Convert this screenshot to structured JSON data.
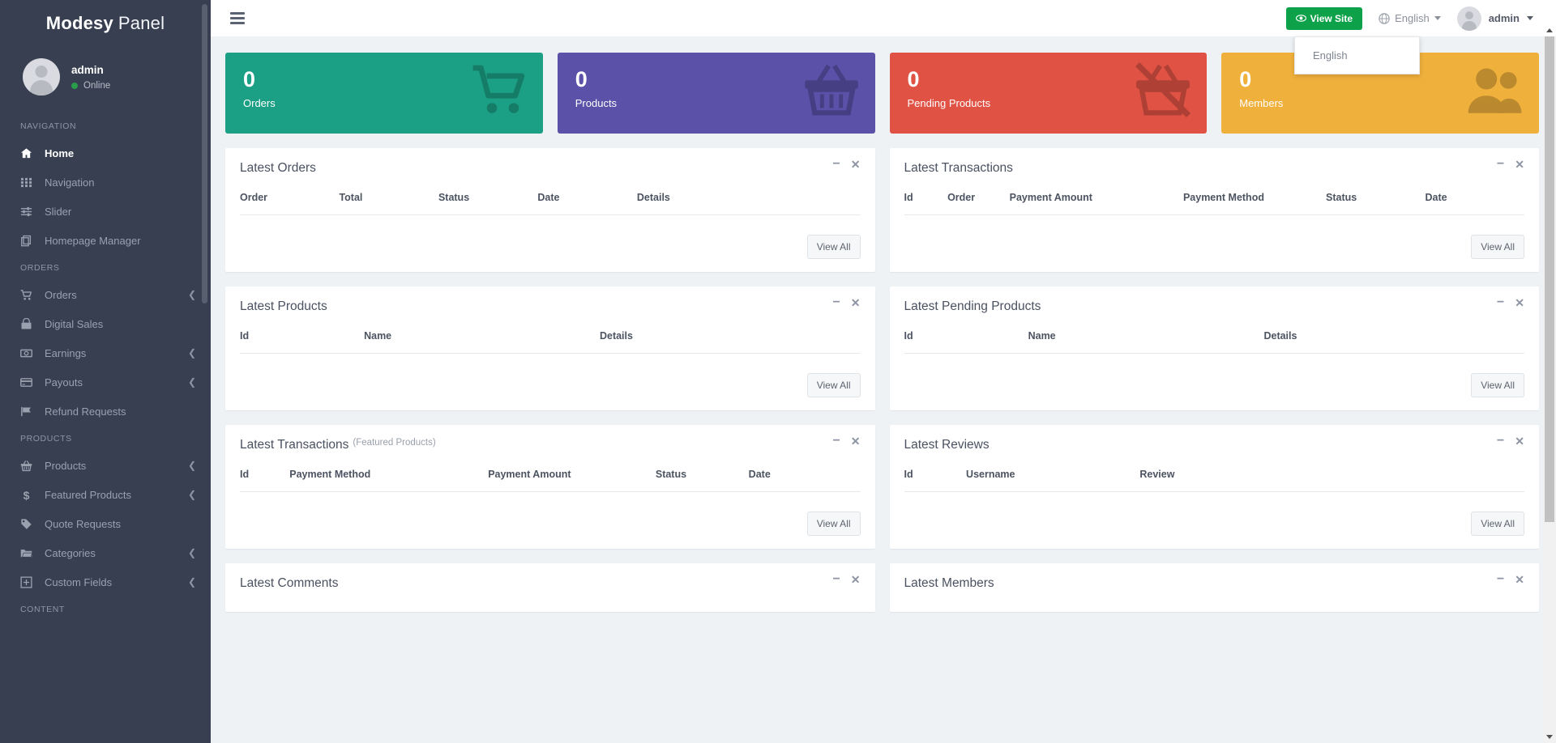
{
  "brand": {
    "bold": "Modesy",
    "light": "Panel"
  },
  "user": {
    "name": "admin",
    "status": "Online"
  },
  "sidebar": {
    "sections": [
      {
        "heading": "NAVIGATION",
        "items": [
          {
            "label": "Home",
            "icon": "home-icon",
            "active": true,
            "caret": false
          },
          {
            "label": "Navigation",
            "icon": "grid-icon",
            "active": false,
            "caret": false
          },
          {
            "label": "Slider",
            "icon": "sliders-icon",
            "active": false,
            "caret": false
          },
          {
            "label": "Homepage Manager",
            "icon": "copy-icon",
            "active": false,
            "caret": false
          }
        ]
      },
      {
        "heading": "ORDERS",
        "items": [
          {
            "label": "Orders",
            "icon": "cart-icon",
            "active": false,
            "caret": true
          },
          {
            "label": "Digital Sales",
            "icon": "bag-icon",
            "active": false,
            "caret": false
          },
          {
            "label": "Earnings",
            "icon": "money-icon",
            "active": false,
            "caret": true
          },
          {
            "label": "Payouts",
            "icon": "card-icon",
            "active": false,
            "caret": true
          },
          {
            "label": "Refund Requests",
            "icon": "flag-icon",
            "active": false,
            "caret": false
          }
        ]
      },
      {
        "heading": "PRODUCTS",
        "items": [
          {
            "label": "Products",
            "icon": "basket-icon",
            "active": false,
            "caret": true
          },
          {
            "label": "Featured Products",
            "icon": "dollar-icon",
            "active": false,
            "caret": true
          },
          {
            "label": "Quote Requests",
            "icon": "tag-icon",
            "active": false,
            "caret": false
          },
          {
            "label": "Categories",
            "icon": "folder-icon",
            "active": false,
            "caret": true
          },
          {
            "label": "Custom Fields",
            "icon": "plus-square-icon",
            "active": false,
            "caret": true
          }
        ]
      },
      {
        "heading": "CONTENT",
        "items": []
      }
    ]
  },
  "topbar": {
    "view_site_label": "View Site",
    "language_label": "English",
    "account_label": "admin",
    "language_options": [
      "English"
    ]
  },
  "stats": [
    {
      "value": "0",
      "label": "Orders",
      "color": "#1ca085",
      "icon": "cart-icon"
    },
    {
      "value": "0",
      "label": "Products",
      "color": "#5b51a8",
      "icon": "basket-icon"
    },
    {
      "value": "0",
      "label": "Pending Products",
      "color": "#e05244",
      "icon": "basket-off-icon"
    },
    {
      "value": "0",
      "label": "Members",
      "color": "#f0b03c",
      "icon": "users-icon"
    }
  ],
  "panels": {
    "left": [
      {
        "title": "Latest Orders",
        "subtitle": "",
        "columns": [
          "Order",
          "Total",
          "Status",
          "Date",
          "Details"
        ],
        "col_widths": [
          "16%",
          "16%",
          "16%",
          "16%",
          "36%"
        ],
        "rows": [],
        "view_all": "View All",
        "has_table": true
      },
      {
        "title": "Latest Products",
        "subtitle": "",
        "columns": [
          "Id",
          "Name",
          "Details"
        ],
        "col_widths": [
          "20%",
          "38%",
          "42%"
        ],
        "rows": [],
        "view_all": "View All",
        "has_table": true
      },
      {
        "title": "Latest Transactions",
        "subtitle": "(Featured Products)",
        "columns": [
          "Id",
          "Payment Method",
          "Payment Amount",
          "Status",
          "Date"
        ],
        "col_widths": [
          "8%",
          "32%",
          "27%",
          "15%",
          "18%"
        ],
        "rows": [],
        "view_all": "View All",
        "has_table": true
      },
      {
        "title": "Latest Comments",
        "subtitle": "",
        "columns": [],
        "col_widths": [],
        "rows": [],
        "view_all": "",
        "has_table": false
      }
    ],
    "right": [
      {
        "title": "Latest Transactions",
        "subtitle": "",
        "columns": [
          "Id",
          "Order",
          "Payment Amount",
          "Payment Method",
          "Status",
          "Date"
        ],
        "col_widths": [
          "7%",
          "10%",
          "28%",
          "23%",
          "16%",
          "16%"
        ],
        "rows": [],
        "view_all": "View All",
        "has_table": true
      },
      {
        "title": "Latest Pending Products",
        "subtitle": "",
        "columns": [
          "Id",
          "Name",
          "Details"
        ],
        "col_widths": [
          "20%",
          "38%",
          "42%"
        ],
        "rows": [],
        "view_all": "View All",
        "has_table": true
      },
      {
        "title": "Latest Reviews",
        "subtitle": "",
        "columns": [
          "Id",
          "Username",
          "Review"
        ],
        "col_widths": [
          "10%",
          "28%",
          "62%"
        ],
        "rows": [],
        "view_all": "View All",
        "has_table": true
      },
      {
        "title": "Latest Members",
        "subtitle": "",
        "columns": [],
        "col_widths": [],
        "rows": [],
        "view_all": "",
        "has_table": false
      }
    ]
  },
  "tools": {
    "minimize": "−",
    "close": "✕"
  }
}
